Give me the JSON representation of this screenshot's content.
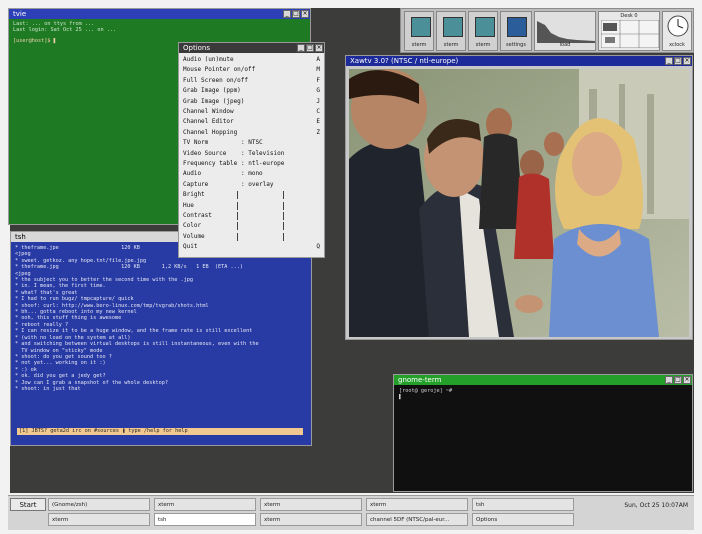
{
  "green_term": {
    "title": "tvie",
    "lines": [
      "Last: ... on ttys from ...",
      "Last login: Sat Oct 25 ... on ...",
      "[user@host]$ ▌"
    ]
  },
  "menu": {
    "title": "Options",
    "items": [
      {
        "label": "Audio (un)mute",
        "key": "A"
      },
      {
        "label": "Mouse Pointer on/off",
        "key": "M"
      },
      {
        "label": "Full Screen on/off",
        "key": "F"
      },
      {
        "label": "Grab Image (ppm)",
        "key": "G"
      },
      {
        "label": "Grab Image (jpeg)",
        "key": "J"
      },
      {
        "label": "Channel Window",
        "key": "C"
      },
      {
        "label": "Channel Editor",
        "key": "E"
      },
      {
        "label": "Channel Hopping",
        "key": "Z"
      },
      {
        "label": "TV Norm",
        "value": ": NTSC",
        "key": ""
      },
      {
        "label": "Video Source",
        "value": ": Television",
        "key": ""
      },
      {
        "label": "Frequency table",
        "value": ": ntl-europe",
        "key": ""
      },
      {
        "label": "Audio",
        "value": ": mono",
        "key": ""
      },
      {
        "label": "Capture",
        "value": ": overlay",
        "key": ""
      },
      {
        "label": "Bright",
        "key": ""
      },
      {
        "label": "Hue",
        "key": ""
      },
      {
        "label": "Contrast",
        "key": ""
      },
      {
        "label": "Color",
        "key": ""
      },
      {
        "label": "Volume",
        "key": ""
      },
      {
        "label": "Quit",
        "key": "Q"
      }
    ]
  },
  "blue_term": {
    "title": "tsh",
    "lines": [
      "* theframe.jpe                    120 KB",
      "<jpeg",
      "* sweet. getkoz. any hope.tnt/file.jpe.jpg",
      "* theframe.jpg                    120 KB       1,2 KB/s   1 EB  (ETA ...)",
      "<jpeg",
      "* the subject you to better the second time with the .jpg",
      "* in. I mean, the first time.",
      "* what? that's great",
      "* I had to run bugz/ tmpcapture/ quick",
      "* shoof: curl: http://www.bero-linux.com/tmp/tvgrab/shots.html",
      "* bh... gotta reboot into my new kernel",
      "* ooh, this stuff thing is awesome",
      "* reboot really ?",
      "* I can resize it to be a huge window, and the frame rate is still excellent",
      "* (with no load on the system at all)",
      "* and switching between virtual desktops is still instantaneous, even with the",
      "  TV window on \"sticky\" mode",
      "* shoot: do you get sound too ?",
      "* not yet... working on it :)",
      "* :) ok",
      "* ok. did you get a jedy get?",
      "* Jow can I grab a snapshot of the whole desktop?",
      "* shoot: in just that"
    ],
    "status": "[1] JBTS? geta2d irc on #sources ❚ type /help for help"
  },
  "video": {
    "title": "Xawtv 3.0? (NTSC / ntl-europe)",
    "overlay_hint": "live TV overlay"
  },
  "black_term": {
    "title": "gnome-term",
    "lines": [
      "[root@ geroje] ~#",
      "▌"
    ]
  },
  "panel": {
    "applets": [
      "xterm",
      "xterm",
      "xterm",
      "settings",
      "load"
    ],
    "desk_label": "Desk 0",
    "clock_label": "xclock"
  },
  "taskbar": {
    "start_label": "Start",
    "row1": [
      "(Gnome/zsh)",
      "xterm",
      "xterm",
      "xterm",
      "tsh"
    ],
    "row2": [
      "xterm",
      "tsh",
      "xterm",
      "channel 5DF (NTSC/pal-eur...",
      "Options"
    ],
    "clock": "Sun, Oct 25 10:07AM"
  }
}
